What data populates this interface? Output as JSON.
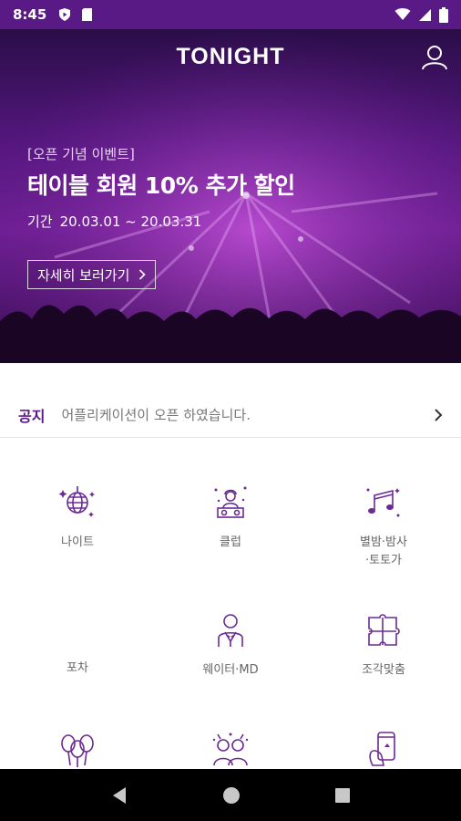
{
  "status_bar": {
    "time": "8:45"
  },
  "app": {
    "brand": "TONIGHT"
  },
  "banner": {
    "tag": "[오픈 기념 이벤트]",
    "title": "테이블 회원 10% 추가 할인",
    "period_label": "기간",
    "period_dates": "20.03.01 ~ 20.03.31",
    "button_label": "자세히 보러가기"
  },
  "notice": {
    "label": "공지",
    "text": "어플리케이션이 오픈 하였습니다."
  },
  "categories": [
    {
      "label": "나이트",
      "icon": "disco-ball-icon"
    },
    {
      "label": "클럽",
      "icon": "dj-icon"
    },
    {
      "label": "별밤·밤사\n·토토가",
      "icon": "music-notes-icon"
    },
    {
      "label": "포차",
      "icon": ""
    },
    {
      "label": "웨이터·MD",
      "icon": "waiter-icon"
    },
    {
      "label": "조각맞춤",
      "icon": "puzzle-icon"
    },
    {
      "label": "",
      "icon": "balloons-icon"
    },
    {
      "label": "",
      "icon": "party-people-icon"
    },
    {
      "label": "",
      "icon": "phone-hand-icon"
    }
  ],
  "colors": {
    "brand_purple": "#5a1a86",
    "icon_purple": "#6b2a94"
  }
}
